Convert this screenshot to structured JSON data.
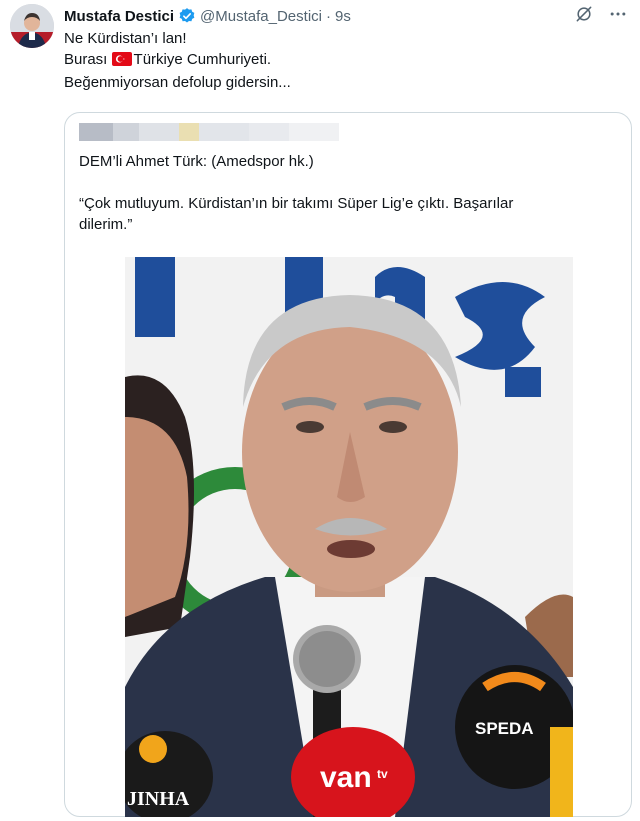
{
  "tweet": {
    "author_name": "Mustafa Destici",
    "handle": "@Mustafa_Destici",
    "separator": "·",
    "time": "9s",
    "lines": [
      "Ne Kürdistan’ı lan!",
      "Burası",
      "Türkiye Cumhuriyeti.",
      "Beğenmiyorsan defolup gidersin..."
    ]
  },
  "quote": {
    "lines": [
      "DEM’li Ahmet Türk: (Amedspor hk.)",
      "“Çok mutluyum. Kürdistan’ın bir takımı Süper Lig’e çıktı. Başarılar",
      "dilerim.”"
    ]
  },
  "photo": {
    "microphone_logos": [
      "SPEDA",
      "van",
      "tv",
      "JINHA"
    ]
  },
  "colors": {
    "text": "#0f1419",
    "secondary": "#536471",
    "verified": "#1d9bf0",
    "border": "#cfd9de"
  },
  "icons": [
    "verified-badge-icon",
    "grok-icon",
    "more-icon",
    "turkey-flag-icon"
  ]
}
